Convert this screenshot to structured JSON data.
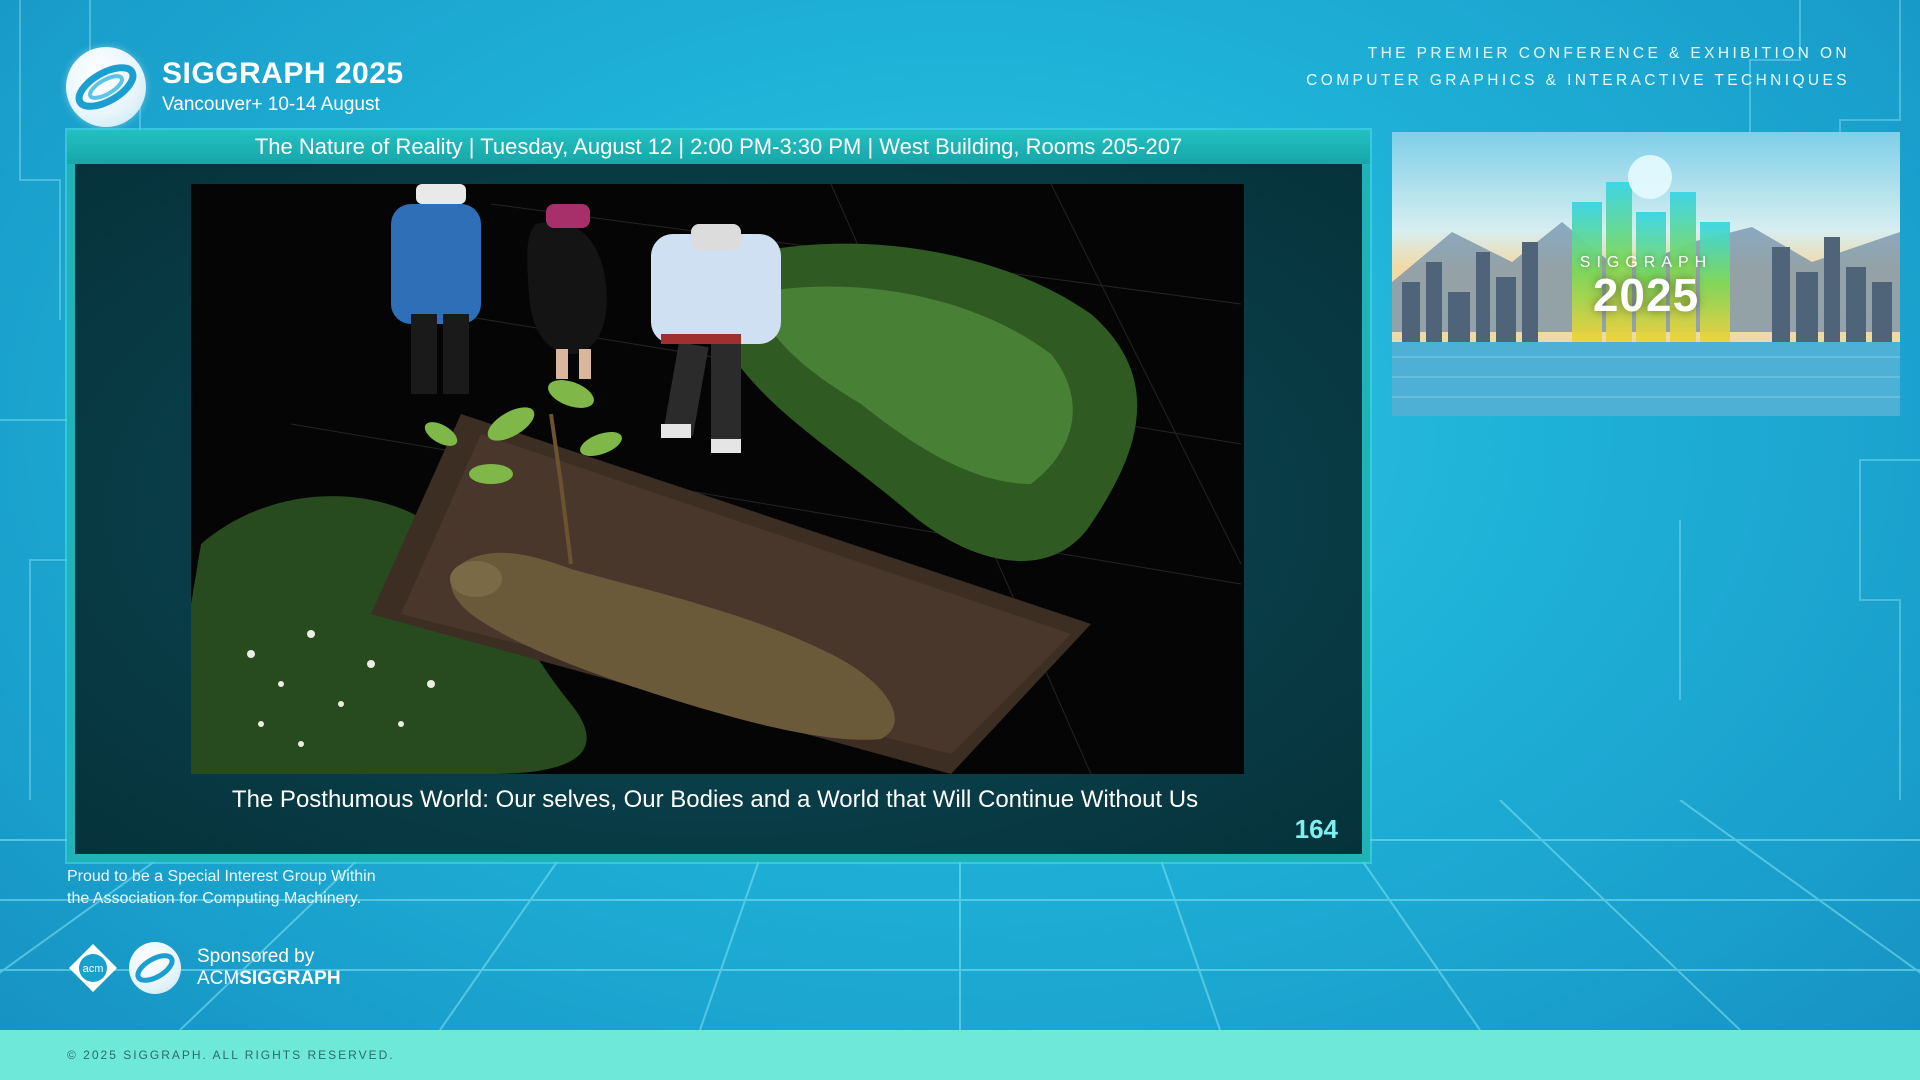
{
  "header": {
    "logo_title": "SIGGRAPH 2025",
    "logo_subtitle": "Vancouver+ 10-14 August",
    "tagline_line1": "THE PREMIER CONFERENCE & EXHIBITION ON",
    "tagline_line2": "COMPUTER GRAPHICS & INTERACTIVE TECHNIQUES"
  },
  "session": {
    "info": "The Nature of Reality | Tuesday, August 12 | 2:00 PM-3:30 PM | West Building, Rooms 205-207"
  },
  "slide": {
    "caption": "The Posthumous World: Our selves, Our Bodies and a World that Will Continue Without Us",
    "number": "164"
  },
  "promo": {
    "label": "SIGGRAPH",
    "year": "2025"
  },
  "footer": {
    "acm_note_line1": "Proud to be a Special Interest Group Within",
    "acm_note_line2": "the Association for Computing Machinery.",
    "acm_logo_text": "acm",
    "sponsor_label": "Sponsored by",
    "sponsor_prefix": "ACM",
    "sponsor_name": "SIGGRAPH",
    "copyright": "© 2025 SIGGRAPH. ALL RIGHTS RESERVED."
  },
  "colors": {
    "background": "#1fb3d8",
    "session_bar": "#1fb2b7",
    "slide_bg": "#083a44",
    "slide_number": "#7ff0f0",
    "bottom_strip": "#6ee9d9"
  },
  "icons": {
    "logo": "siggraph-orbit-logo",
    "acm": "acm-diamond-logo"
  }
}
